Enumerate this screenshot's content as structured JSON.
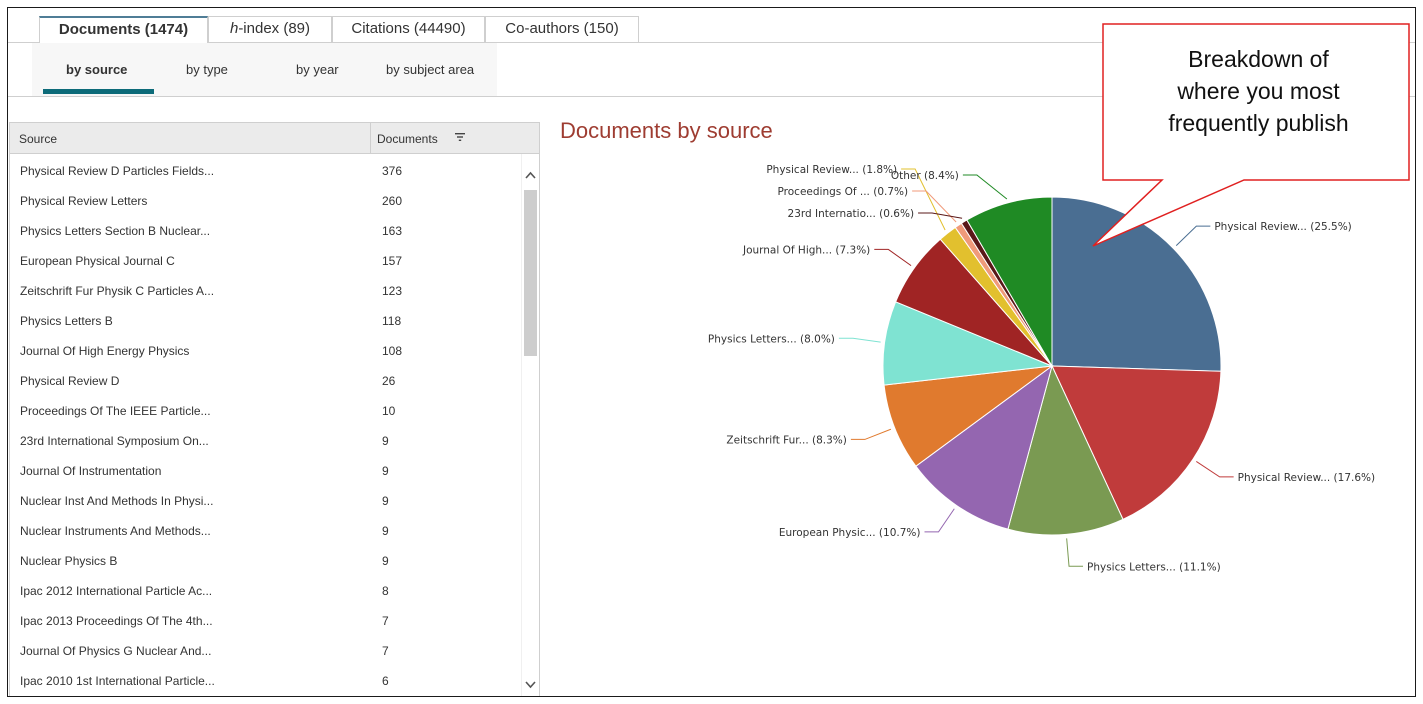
{
  "tabs": [
    {
      "label": "Documents (1474)",
      "prefix": "",
      "suffix": ""
    },
    {
      "label": "",
      "prefix": "h",
      "suffix": "-index (89)"
    },
    {
      "label": "Citations (44490)",
      "prefix": "",
      "suffix": ""
    },
    {
      "label": "Co-authors (150)",
      "prefix": "",
      "suffix": ""
    }
  ],
  "subtabs": [
    "by source",
    "by type",
    "by year",
    "by subject area"
  ],
  "table": {
    "col_source": "Source",
    "col_documents": "Documents",
    "rows": [
      {
        "source": "Physical Review D Particles Fields...",
        "documents": "376"
      },
      {
        "source": "Physical Review Letters",
        "documents": "260"
      },
      {
        "source": "Physics Letters Section B Nuclear...",
        "documents": "163"
      },
      {
        "source": "European Physical Journal C",
        "documents": "157"
      },
      {
        "source": "Zeitschrift Fur Physik C Particles A...",
        "documents": "123"
      },
      {
        "source": "Physics Letters B",
        "documents": "118"
      },
      {
        "source": "Journal Of High Energy Physics",
        "documents": "108"
      },
      {
        "source": "Physical Review D",
        "documents": "26"
      },
      {
        "source": "Proceedings Of The IEEE Particle...",
        "documents": "10"
      },
      {
        "source": "23rd International Symposium On...",
        "documents": "9"
      },
      {
        "source": "Journal Of Instrumentation",
        "documents": "9"
      },
      {
        "source": "Nuclear Inst And Methods In Physi...",
        "documents": "9"
      },
      {
        "source": "Nuclear Instruments And Methods...",
        "documents": "9"
      },
      {
        "source": "Nuclear Physics B",
        "documents": "9"
      },
      {
        "source": "Ipac 2012 International Particle Ac...",
        "documents": "8"
      },
      {
        "source": "Ipac 2013 Proceedings Of The 4th...",
        "documents": "7"
      },
      {
        "source": "Journal Of Physics G Nuclear And...",
        "documents": "7"
      },
      {
        "source": "Ipac 2010 1st International Particle...",
        "documents": "6"
      }
    ]
  },
  "chart_title": "Documents by source",
  "chart_data": {
    "type": "pie",
    "title": "Documents by source",
    "slices": [
      {
        "label": "Physical Review... (25.5%)",
        "value": 25.5,
        "color": "#4a6e92"
      },
      {
        "label": "Physical Review... (17.6%)",
        "value": 17.6,
        "color": "#c03b3b"
      },
      {
        "label": "Physics Letters... (11.1%)",
        "value": 11.1,
        "color": "#7a9a52"
      },
      {
        "label": "European Physic... (10.7%)",
        "value": 10.7,
        "color": "#9466b0"
      },
      {
        "label": "Zeitschrift Fur... (8.3%)",
        "value": 8.3,
        "color": "#e07a2e"
      },
      {
        "label": "Physics Letters... (8.0%)",
        "value": 8.0,
        "color": "#7fe3d2"
      },
      {
        "label": "Journal Of High... (7.3%)",
        "value": 7.3,
        "color": "#a02424"
      },
      {
        "label": "Physical Review... (1.8%)",
        "value": 1.8,
        "color": "#e2c02e"
      },
      {
        "label": "Proceedings Of ... (0.7%)",
        "value": 0.7,
        "color": "#f09a7a"
      },
      {
        "label": "23rd Internatio... (0.6%)",
        "value": 0.6,
        "color": "#5a1818"
      },
      {
        "label": "Other (8.4%)",
        "value": 8.4,
        "color": "#1f8a24"
      }
    ]
  },
  "callout": {
    "lines": [
      "Breakdown of",
      "where you most",
      "frequently publish"
    ],
    "border_color": "#e02020"
  }
}
